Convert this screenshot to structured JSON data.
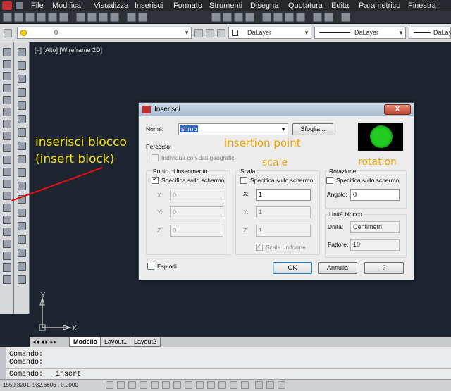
{
  "menu": [
    "File",
    "Modifica",
    "Visualizza",
    "Inserisci",
    "Formato",
    "Strumenti",
    "Disegna",
    "Quotatura",
    "Edita",
    "Parametrico",
    "Finestra"
  ],
  "toolbar": {
    "layer_value": "0",
    "color_value": "DaLayer",
    "linetype_value": "DaLayer",
    "lineweight_value": "DaLayer"
  },
  "viewport_label": "[–] [Alto] [Wireframe 2D]",
  "annotations": {
    "insert_block_line1": "inserisci blocco",
    "insert_block_line2": "(insert block)",
    "insertion_point": "insertion point",
    "scale": "scale",
    "rotation": "rotation",
    "arrow_color": "#e01010",
    "text_color": "#f0a500"
  },
  "dialog": {
    "title": "Inserisci",
    "close_glyph": "X",
    "name_label": "Nome:",
    "name_value": "shrub",
    "browse_label": "Sfoglia...",
    "path_label": "Percorso:",
    "geo_label": "Individua con dati geografici",
    "insertion": {
      "title": "Punto di inserimento",
      "onscreen_label": "Specifica sullo schermo",
      "onscreen_checked": true,
      "x_label": "X:",
      "x_value": "0",
      "y_label": "Y:",
      "y_value": "0",
      "z_label": "Z:",
      "z_value": "0"
    },
    "scale": {
      "title": "Scala",
      "onscreen_label": "Specifica sullo schermo",
      "onscreen_checked": false,
      "x_label": "X:",
      "x_value": "1",
      "y_label": "Y:",
      "y_value": "1",
      "z_label": "Z:",
      "z_value": "1",
      "uniform_label": "Scala uniforme",
      "uniform_checked": true
    },
    "rotation": {
      "title": "Rotazione",
      "onscreen_label": "Specifica sullo schermo",
      "onscreen_checked": false,
      "angle_label": "Angolo:",
      "angle_value": "0"
    },
    "block_unit": {
      "title": "Unità blocco",
      "unit_label": "Unità:",
      "unit_value": "Centimetri",
      "factor_label": "Fattore:",
      "factor_value": "10"
    },
    "explode_label": "Esplodi",
    "explode_checked": false,
    "ok_label": "OK",
    "cancel_label": "Annulla",
    "help_label": "?",
    "preview_color": "#22cc22"
  },
  "ucs": {
    "x": "X",
    "y": "Y"
  },
  "tabs": [
    "Modello",
    "Layout1",
    "Layout2"
  ],
  "command_lines": [
    "Comando:",
    "Comando:"
  ],
  "command_prompt": "Comando:",
  "command_value": "_insert",
  "coordinates": "1550.8201, 932.6606 , 0.0000"
}
